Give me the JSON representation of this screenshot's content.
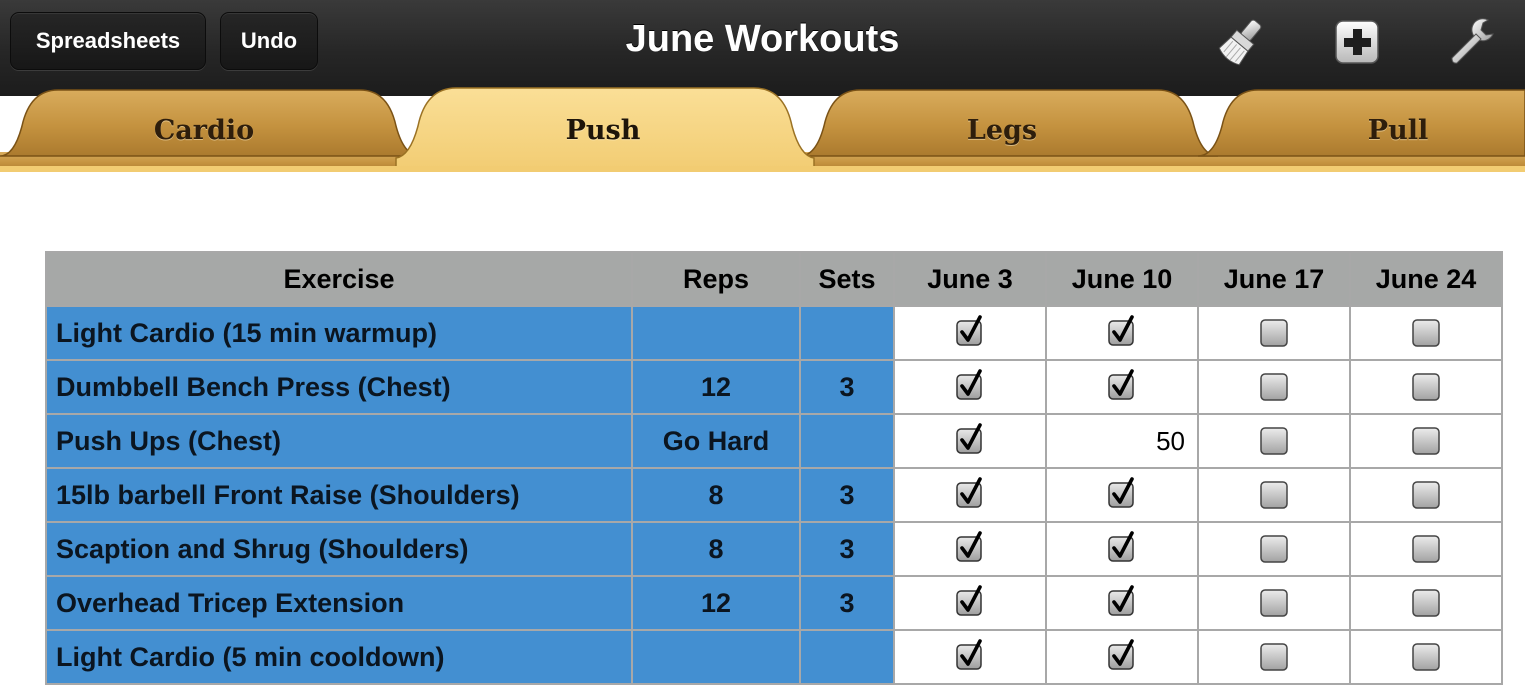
{
  "toolbar": {
    "spreadsheets_label": "Spreadsheets",
    "undo_label": "Undo",
    "title": "June Workouts",
    "icons": [
      "paintbrush-icon",
      "add-icon",
      "wrench-icon"
    ]
  },
  "tabs": [
    {
      "label": "Cardio",
      "active": false
    },
    {
      "label": "Push",
      "active": true
    },
    {
      "label": "Legs",
      "active": false
    },
    {
      "label": "Pull",
      "active": false
    }
  ],
  "table": {
    "headers": [
      "Exercise",
      "Reps",
      "Sets",
      "June 3",
      "June 10",
      "June 17",
      "June 24"
    ],
    "rows": [
      {
        "exercise": "Light Cardio (15 min warmup)",
        "reps": "",
        "sets": "",
        "june3": true,
        "june10": true,
        "june17": false,
        "june24": false
      },
      {
        "exercise": "Dumbbell Bench Press (Chest)",
        "reps": "12",
        "sets": "3",
        "june3": true,
        "june10": true,
        "june17": false,
        "june24": false
      },
      {
        "exercise": "Push Ups (Chest)",
        "reps": "Go Hard",
        "sets": "",
        "june3": true,
        "june10": "50",
        "june17": false,
        "june24": false
      },
      {
        "exercise": "15lb barbell Front Raise (Shoulders)",
        "reps": "8",
        "sets": "3",
        "june3": true,
        "june10": true,
        "june17": false,
        "june24": false
      },
      {
        "exercise": "Scaption and Shrug (Shoulders)",
        "reps": "8",
        "sets": "3",
        "june3": true,
        "june10": true,
        "june17": false,
        "june24": false
      },
      {
        "exercise": "Overhead Tricep Extension",
        "reps": "12",
        "sets": "3",
        "june3": true,
        "june10": true,
        "june17": false,
        "june24": false
      },
      {
        "exercise": "Light Cardio (5 min cooldown)",
        "reps": "",
        "sets": "",
        "june3": true,
        "june10": true,
        "june17": false,
        "june24": false
      }
    ]
  },
  "colors": {
    "toolbar_bg": "#262626",
    "tab_active": "#f5d37f",
    "tab_inactive": "#c99a4a",
    "exercise_cell": "#438fd1",
    "header_cell": "#a6a8a7"
  }
}
